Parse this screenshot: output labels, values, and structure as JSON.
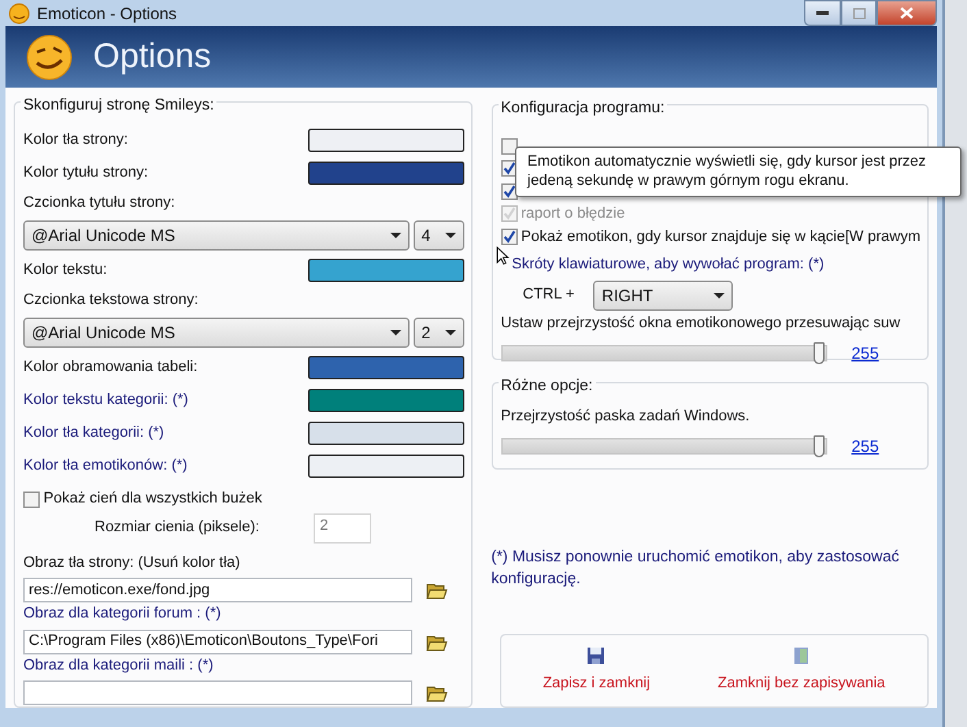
{
  "window": {
    "title": "Emoticon - Options"
  },
  "header": {
    "title": "Options"
  },
  "page_settings": {
    "legend": "Skonfiguruj stronę Smileys:",
    "rows": [
      {
        "kind": "color",
        "label": "Kolor tła strony:",
        "restart": false,
        "color": "#eef0f4"
      },
      {
        "kind": "color",
        "label": "Kolor tytułu strony:",
        "restart": false,
        "color": "#21428c"
      },
      {
        "kind": "font",
        "label": "Czcionka tytułu strony:",
        "restart": false,
        "font": "@Arial Unicode MS",
        "size": "4"
      },
      {
        "kind": "color",
        "label": "Kolor tekstu:",
        "restart": false,
        "color": "#35a3cf"
      },
      {
        "kind": "font",
        "label": "Czcionka tekstowa strony:",
        "restart": false,
        "font": "@Arial Unicode MS",
        "size": "2"
      },
      {
        "kind": "color",
        "label": "Kolor obramowania tabeli:",
        "restart": false,
        "color": "#2e63ad"
      },
      {
        "kind": "color",
        "label": "Kolor tekstu kategorii: (*)",
        "restart": true,
        "color": "#00807b"
      },
      {
        "kind": "color",
        "label": "Kolor tła kategorii: (*)",
        "restart": true,
        "color": "#d7e0ea"
      },
      {
        "kind": "color",
        "label": "Kolor tła emotikonów: (*)",
        "restart": true,
        "color": "#edf0f4"
      }
    ],
    "shadow": {
      "label": "Pokaż cień dla wszystkich bużek",
      "checked": false
    },
    "shadow_size": {
      "label": "Rozmiar cienia (piksele):",
      "value": "2",
      "disabled": true
    },
    "images": [
      {
        "label": "Obraz tła strony: (Usuń kolor tła)",
        "restart": false,
        "value": "res://emoticon.exe/fond.jpg"
      },
      {
        "label": "Obraz dla kategorii forum : (*)",
        "restart": true,
        "value": "C:\\Program Files (x86)\\Emoticon\\Boutons_Type\\Fori"
      },
      {
        "label": "Obraz dla kategorii maili : (*)",
        "restart": true
      }
    ]
  },
  "program": {
    "legend": "Konfiguracja programu:",
    "checkboxes": [
      {
        "checked": false,
        "disabled": false
      },
      {
        "checked": true,
        "disabled": false
      },
      {
        "checked": true,
        "disabled": false
      },
      {
        "label": "raport o błędzie",
        "checked": true,
        "disabled": true
      },
      {
        "label": "Pokaż emotikon, gdy kursor znajduje się w kącie[W prawym",
        "checked": true,
        "disabled": false
      }
    ],
    "shortcut_label": "Skróty klawiaturowe, aby wywołać program: (*)",
    "ctrl_label": "CTRL +",
    "key": "RIGHT",
    "opacity_label": "Ustaw przejrzystość okna emotikonowego przesuwając suw",
    "opacity": {
      "level": 1,
      "reading": "255"
    }
  },
  "misc": {
    "legend": "Różne opcje:",
    "label": "Przejrzystość paska zadań Windows.",
    "taskbar": {
      "level": 1,
      "reading": "255"
    }
  },
  "note": "(*) Musisz ponownie uruchomić emotikon, aby zastosować konfigurację.",
  "buttons": [
    {
      "kind": "save",
      "label": "Zapisz i zamknij"
    },
    {
      "kind": "close",
      "label": "Zamknij bez zapisywania"
    }
  ],
  "tooltip": "Emotikon automatycznie wyświetli się, gdy kursor jest przez jedeną sekundę w prawym górnym rogu ekranu."
}
